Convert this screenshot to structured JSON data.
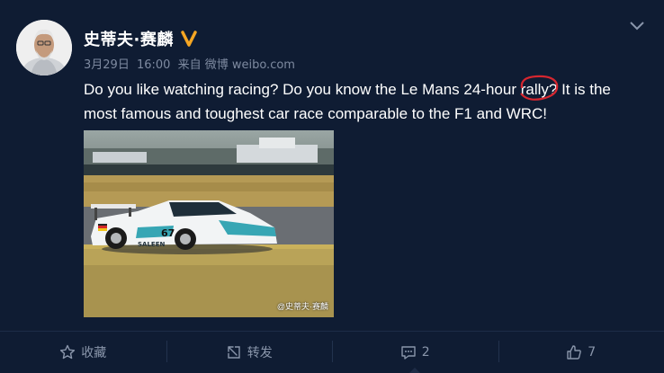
{
  "user": {
    "name": "史蒂夫·赛麟",
    "verified": true
  },
  "meta": {
    "date": "3月29日",
    "time": "16:00",
    "source": "来自 微博 weibo.com"
  },
  "post": {
    "text_before": "Do you like watching racing? Do you know the Le Mans 24-hour ",
    "highlight": "rally?",
    "text_after": " It is the most famous and toughest car race comparable to the F1 and WRC!",
    "annotation_color": "#d6262f"
  },
  "photo": {
    "watermark": "@史蒂夫·赛麟",
    "car_number": "67",
    "car_brand": "SALEEN"
  },
  "actions": {
    "favorite": {
      "label": "收藏"
    },
    "repost": {
      "label": "转发"
    },
    "comment": {
      "count": "2"
    },
    "like": {
      "count": "7"
    }
  },
  "colors": {
    "background": "#0f1c33",
    "meta": "#7e8aa0",
    "verified": "#f5a623"
  }
}
